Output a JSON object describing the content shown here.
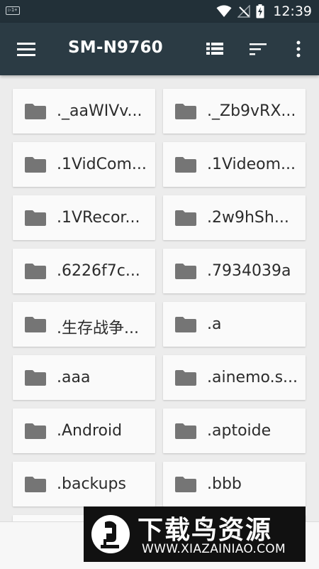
{
  "status_bar": {
    "notification_icon": "screen-cast-icon",
    "notification_text": "▷1+",
    "icons": [
      "wifi-icon",
      "no-signal-icon",
      "battery-charging-icon"
    ],
    "time": "12:39"
  },
  "app_bar": {
    "title": "SM-N9760",
    "actions": [
      "menu-icon",
      "list-view-icon",
      "sort-icon",
      "more-vert-icon"
    ]
  },
  "folders": [
    "._aaWIVv...",
    "._Zb9vRX...",
    ".1VidCom...",
    ".1Videom...",
    ".1VRecor...",
    ".2w9hSh...",
    ".6226f7c...",
    ".7934039a",
    ".生存战争...",
    ".a",
    ".aaa",
    ".ainemo.s...",
    ".Android",
    ".aptoide",
    ".backups",
    ".bbb"
  ],
  "watermark": {
    "brand": "下载鸟资源",
    "url": "WWW.XIAZAINIAO.COM"
  },
  "colors": {
    "status_bar": "#223038",
    "app_bar": "#2b3b44",
    "folder_icon": "#757575",
    "tile": "#fafafa",
    "background": "#ececec"
  }
}
